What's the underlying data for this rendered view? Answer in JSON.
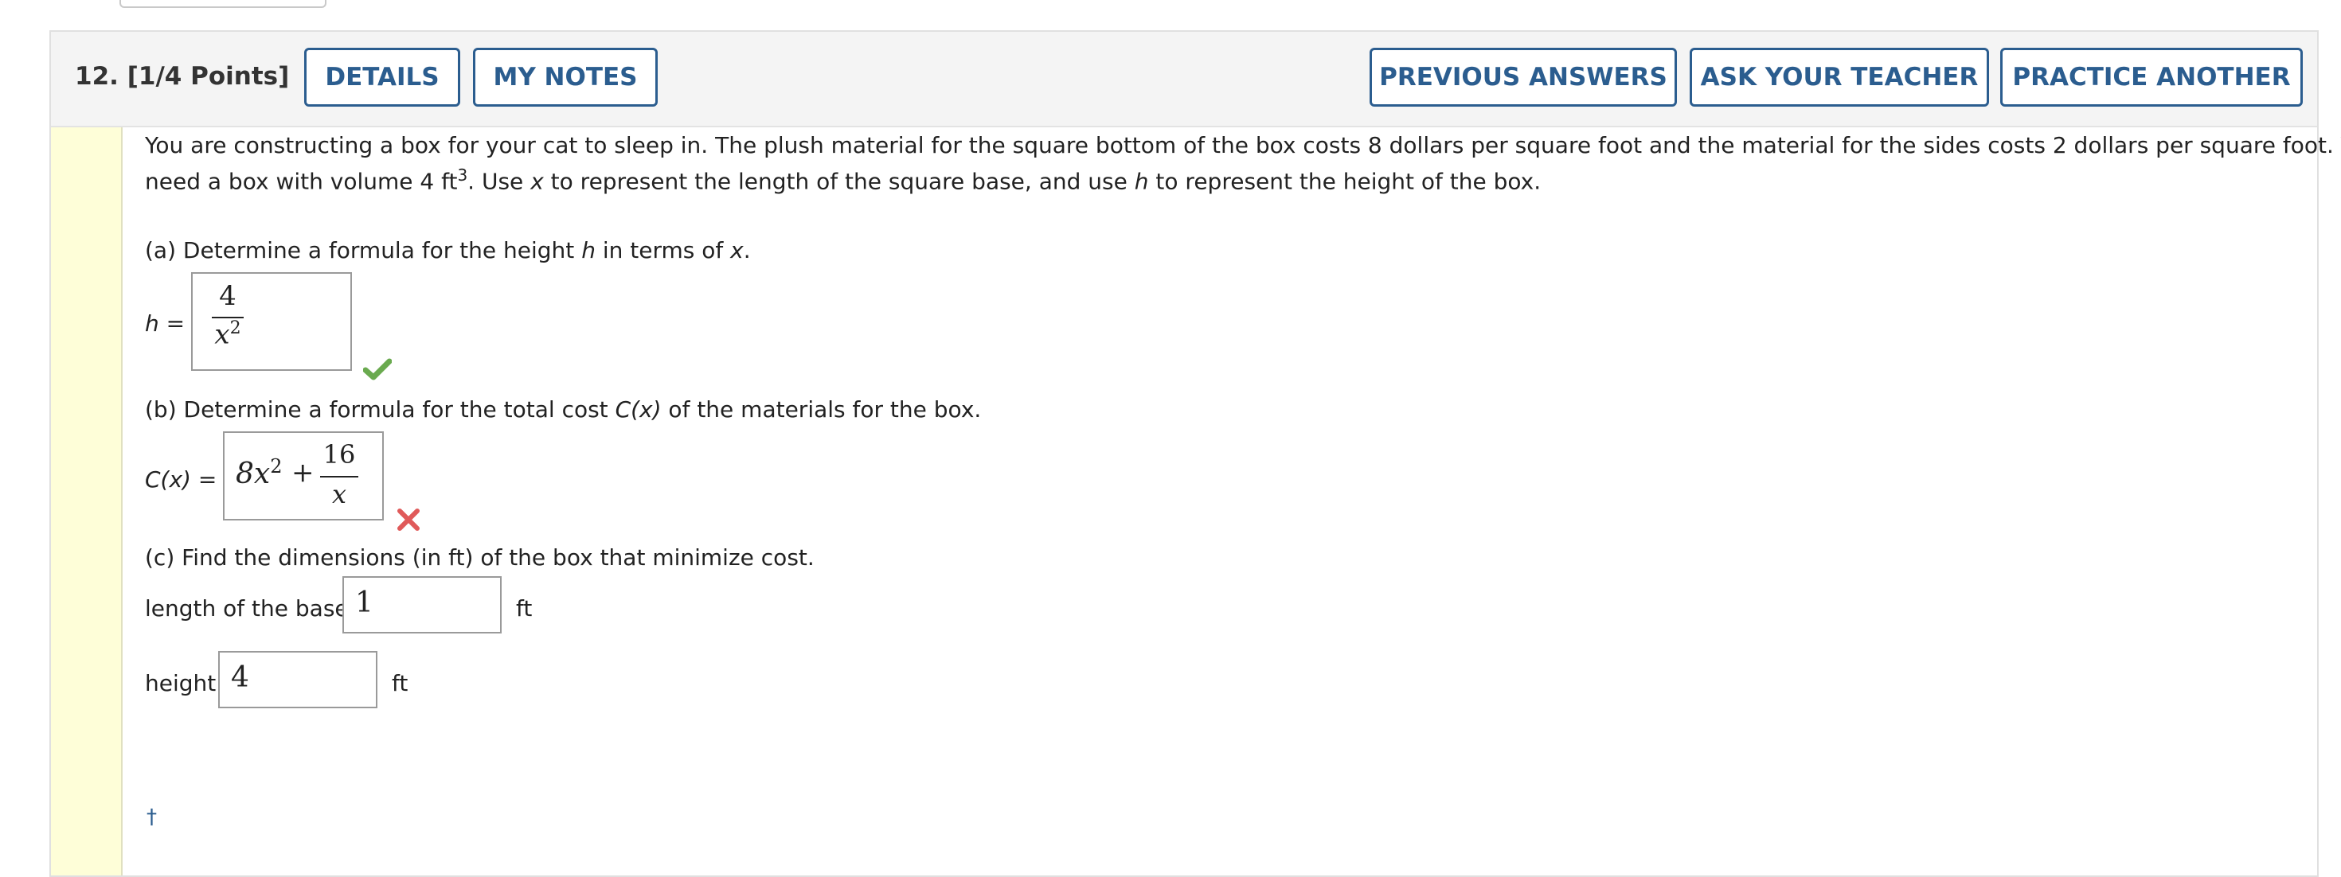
{
  "question": {
    "number_points": "12.  [1/4 Points]",
    "buttons": {
      "details": "DETAILS",
      "my_notes": "MY NOTES",
      "previous_answers": "PREVIOUS ANSWERS",
      "ask_teacher": "ASK YOUR TEACHER",
      "practice_another": "PRACTICE ANOTHER"
    }
  },
  "prompt": {
    "line1": "You are constructing a box for your cat to sleep in. The plush material for the square bottom of the box costs 8 dollars per square foot and the material for the sides costs 2 dollars per square foot. You",
    "line2_a": "need a box with volume 4 ft",
    "line2_sup": "3",
    "line2_b": ". Use ",
    "var_x": "x",
    "line2_c": " to represent the length of the square base, and use ",
    "var_h": "h",
    "line2_d": " to represent the height of the box."
  },
  "part_a": {
    "q_a": "(a) Determine a formula for the height ",
    "q_h": "h",
    "q_b": " in terms of ",
    "q_x": "x",
    "q_c": ".",
    "label_h": "h",
    "label_eq": " =",
    "answer_num": "4",
    "answer_den_base": "x",
    "answer_den_exp": "2",
    "status": "correct"
  },
  "part_b": {
    "q_a": "(b) Determine a formula for the total cost ",
    "q_cx": "C(x)",
    "q_b": " of the materials for the box.",
    "label": "C(x)",
    "label_eq": " =",
    "answer_term1_coef": "8x",
    "answer_term1_exp": "2",
    "answer_plus": "+",
    "answer_num": "16",
    "answer_den": "x",
    "status": "incorrect"
  },
  "part_c": {
    "question": "(c) Find the dimensions (in ft) of the box that minimize cost.",
    "base_label": "length of the base",
    "base_value": "1",
    "base_unit": "ft",
    "height_label": "height",
    "height_value": "4",
    "height_unit": "ft"
  },
  "footnote_mark": "†",
  "colors": {
    "button_blue": "#2b5d8f",
    "correct_green": "#6aaa4f",
    "incorrect_red": "#e05a5a",
    "gutter_yellow": "#fefed8"
  }
}
